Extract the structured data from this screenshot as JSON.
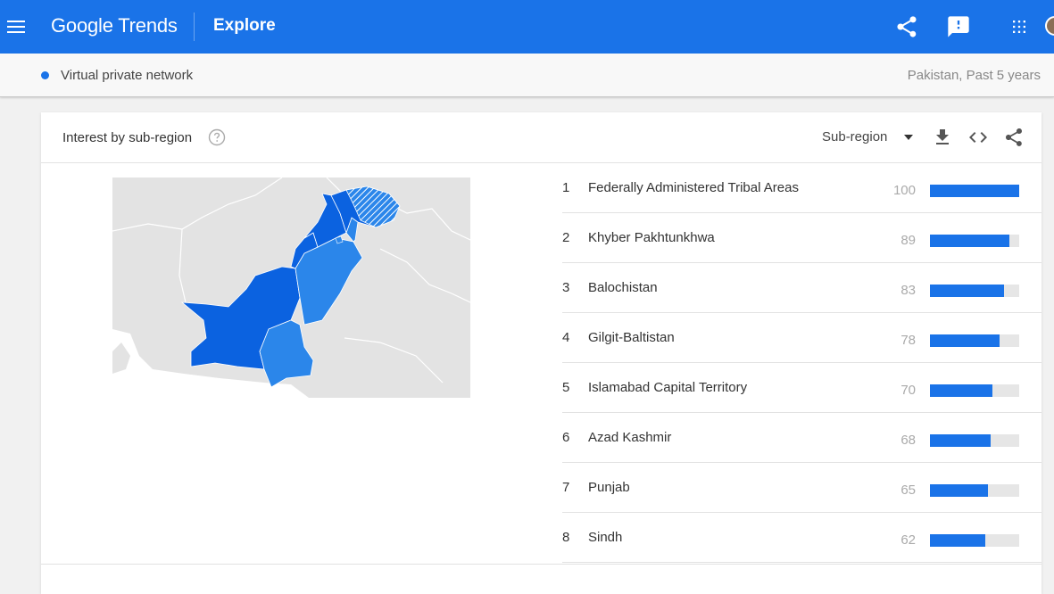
{
  "header": {
    "logo": "Google Trends",
    "section": "Explore",
    "icons": [
      "menu-icon",
      "share-icon",
      "feedback-icon",
      "apps-grid-icon",
      "avatar"
    ]
  },
  "term": {
    "label": "Virtual private network",
    "meta": "Pakistan, Past 5 years",
    "color": "#1a73e8"
  },
  "card": {
    "title": "Interest by sub-region",
    "resolution": "Sub-region",
    "icons": [
      "help-icon",
      "download-icon",
      "embed-icon",
      "share-icon"
    ]
  },
  "regions": [
    {
      "rank": "1",
      "name": "Federally Administered Tribal Areas",
      "value": 100
    },
    {
      "rank": "2",
      "name": "Khyber Pakhtunkhwa",
      "value": 89
    },
    {
      "rank": "3",
      "name": "Balochistan",
      "value": 83
    },
    {
      "rank": "4",
      "name": "Gilgit-Baltistan",
      "value": 78
    },
    {
      "rank": "5",
      "name": "Islamabad Capital Territory",
      "value": 70
    },
    {
      "rank": "6",
      "name": "Azad Kashmir",
      "value": 68
    },
    {
      "rank": "7",
      "name": "Punjab",
      "value": 65
    },
    {
      "rank": "8",
      "name": "Sindh",
      "value": 62
    }
  ],
  "colors": {
    "brand": "#1a73e8",
    "bar_track": "#e6e6e6",
    "map_dark": "#0b62e0",
    "map_medium": "#2b86ea",
    "map_land": "#e3e3e3"
  }
}
